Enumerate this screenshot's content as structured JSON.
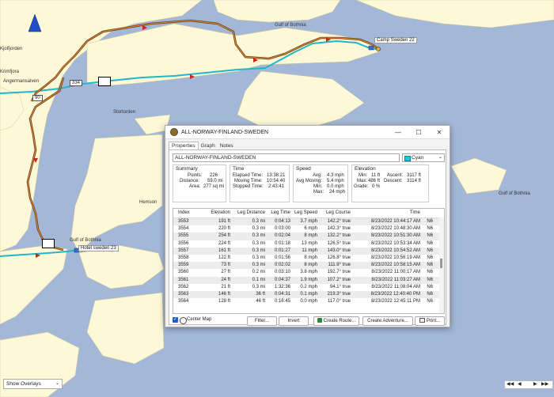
{
  "map": {
    "labels": {
      "kjolfjorden": "Kjolfjorden",
      "krimfjora": "Krimfjora",
      "angermansalven": "Angermansalven",
      "gulf_bothnia_top": "Gulf of Bothnia",
      "gulf_bothnia_mid": "Gulf of Bothnia",
      "gulf_bothnia_bottom": "Gulf of Bothnia",
      "stortorden": "Stortorden",
      "hemson": "Hemson"
    },
    "route_shields": [
      "334",
      "90"
    ],
    "waypoints": {
      "camp": "Camp Sweden 22",
      "hotel": "Hotel sweden 23"
    },
    "route_color": "#20b8c8",
    "track_color": "#6b3a12"
  },
  "dialog": {
    "title": "ALL-NORWAY-FINLAND-SWEDEN",
    "tabs": [
      "Properties",
      "Graph",
      "Notes"
    ],
    "name": "ALL-NORWAY-FINLAND-SWEDEN",
    "color": {
      "name": "Cyan",
      "hex": "#20c8d8"
    },
    "summary": {
      "title": "Summary",
      "points_label": "Points:",
      "points": "226",
      "distance_label": "Distance:",
      "distance": "59.0 mi",
      "area_label": "Area:",
      "area": "277 sq mi"
    },
    "time": {
      "title": "Time",
      "elapsed_label": "Elapsed Time:",
      "elapsed": "13:38:21",
      "moving_label": "Moving Time:",
      "moving": "10:54:40",
      "stopped_label": "Stopped Time:",
      "stopped": "2:43:41"
    },
    "speed": {
      "title": "Speed",
      "avg_label": "Avg:",
      "avg": "4.3 mph",
      "avg_moving_label": "Avg Moving:",
      "avg_moving": "5.4 mph",
      "min_label": "Min:",
      "min": "0.0 mph",
      "max_label": "Max:",
      "max": "24 mph"
    },
    "elevation": {
      "title": "Elevation",
      "min_label": "Min:",
      "min": "11 ft",
      "max_label": "Max:",
      "max": "486 ft",
      "grade_label": "Grade:",
      "grade": "0 %",
      "ascent_label": "Ascent:",
      "ascent": "3117 ft",
      "descent_label": "Descent:",
      "descent": "3114 ft"
    },
    "table": {
      "headers": [
        "Index",
        "Elevation",
        "Leg Distance",
        "Leg Time",
        "Leg Speed",
        "Leg Course",
        "Time",
        ""
      ],
      "rows": [
        [
          "3553",
          "191 ft",
          "0.3 mi",
          "0:04:13",
          "3.7 mph",
          "142.2° true",
          "8/23/2022 10:44:17 AM",
          "N6"
        ],
        [
          "3554",
          "220 ft",
          "0.3 mi",
          "0:03:00",
          "6 mph",
          "142.3° true",
          "8/23/2022 10:48:30 AM",
          "N6"
        ],
        [
          "3555",
          "254 ft",
          "0.3 mi",
          "0:02:04",
          "8 mph",
          "132.2° true",
          "8/23/2022 10:51:30 AM",
          "N6"
        ],
        [
          "3556",
          "224 ft",
          "0.3 mi",
          "0:01:18",
          "13 mph",
          "126.5° true",
          "8/23/2022 10:53:34 AM",
          "N6"
        ],
        [
          "3557",
          "161 ft",
          "0.3 mi",
          "0:01:27",
          "11 mph",
          "143.0° true",
          "8/23/2022 10:54:52 AM",
          "N6"
        ],
        [
          "3558",
          "122 ft",
          "0.3 mi",
          "0:01:56",
          "8 mph",
          "126.8° true",
          "8/23/2022 10:56:19 AM",
          "N6"
        ],
        [
          "3559",
          "73 ft",
          "0.3 mi",
          "0:02:02",
          "8 mph",
          "111.9° true",
          "8/23/2022 10:58:15 AM",
          "N6"
        ],
        [
          "3560",
          "27 ft",
          "0.2 mi",
          "0:03:10",
          "3.8 mph",
          "192.7° true",
          "8/23/2022 11:00:17 AM",
          "N6"
        ],
        [
          "3561",
          "24 ft",
          "0.1 mi",
          "0:04:37",
          "1.9 mph",
          "107.2° true",
          "8/23/2022 11:03:27 AM",
          "N6"
        ],
        [
          "3562",
          "21 ft",
          "0.3 mi",
          "1:32:36",
          "0.2 mph",
          "94.1° true",
          "8/23/2022 11:08:04 AM",
          "N6"
        ],
        [
          "3563",
          "146 ft",
          "36 ft",
          "0:04:31",
          "0.1 mph",
          "219.3° true",
          "8/23/2022 12:40:40 PM",
          "N6"
        ],
        [
          "3564",
          "128 ft",
          "46 ft",
          "0:16:45",
          "0.0 mph",
          "117.0° true",
          "8/23/2022 12:45:11 PM",
          "N6"
        ]
      ]
    },
    "footer": {
      "center_map": "Center Map",
      "filter": "Filter...",
      "invert": "Invert",
      "create_route": "Create Route...",
      "create_adventure": "Create Adventure...",
      "print": "Print..."
    }
  },
  "overlays": {
    "selected": "Show Overlays"
  },
  "page_nav": {
    "value": ""
  }
}
